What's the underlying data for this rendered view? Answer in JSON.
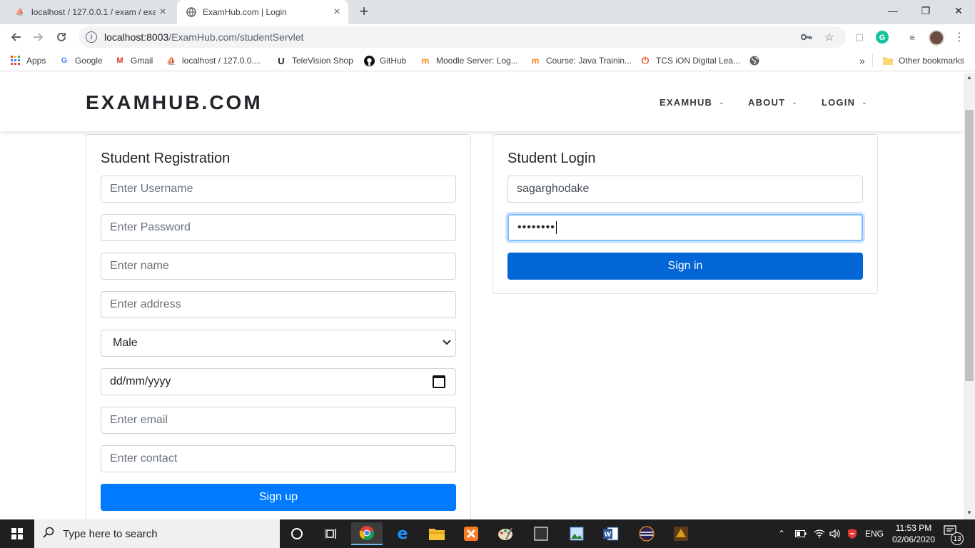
{
  "browser": {
    "tabs": [
      {
        "title": "localhost / 127.0.0.1 / exam / exa",
        "active": false,
        "favicon": "phpmyadmin-icon"
      },
      {
        "title": "ExamHub.com | Login",
        "active": true,
        "favicon": "globe-icon"
      }
    ],
    "window_controls": {
      "minimize": "—",
      "maximize": "❐",
      "close": "✕"
    },
    "url_host": "localhost:8003",
    "url_path": "/ExamHub.com/studentServlet",
    "bookmarks": [
      {
        "label": "Apps",
        "icon": "apps-grid-icon"
      },
      {
        "label": "Google",
        "icon": "google-icon"
      },
      {
        "label": "Gmail",
        "icon": "gmail-icon"
      },
      {
        "label": "localhost / 127.0.0....",
        "icon": "phpmyadmin-icon"
      },
      {
        "label": "TeleVision Shop",
        "icon": "tv-shop-icon"
      },
      {
        "label": "GitHub",
        "icon": "github-icon"
      },
      {
        "label": "Moodle Server: Log...",
        "icon": "moodle-icon"
      },
      {
        "label": "Course: Java Trainin...",
        "icon": "moodle-icon"
      },
      {
        "label": "TCS iON Digital Lea...",
        "icon": "tcs-ion-icon"
      },
      {
        "label": "",
        "icon": "globe-icon"
      }
    ],
    "overflow": "»",
    "other_bookmarks": "Other bookmarks"
  },
  "site": {
    "brand": "EXAMHUB.COM",
    "nav": [
      {
        "label": "EXAMHUB"
      },
      {
        "label": "ABOUT"
      },
      {
        "label": "LOGIN"
      }
    ]
  },
  "registration": {
    "title": "Student Registration",
    "username_placeholder": "Enter Username",
    "password_placeholder": "Enter Password",
    "name_placeholder": "Enter name",
    "address_placeholder": "Enter address",
    "gender_selected": "Male",
    "dob_placeholder": "dd/mm/yyyy",
    "email_placeholder": "Enter email",
    "contact_placeholder": "Enter contact",
    "submit_label": "Sign up"
  },
  "login": {
    "title": "Student Login",
    "username_value": "sagarghodake",
    "password_masked": "••••••••",
    "submit_label": "Sign in"
  },
  "taskbar": {
    "search_placeholder": "Type here to search",
    "language": "ENG",
    "time": "11:53 PM",
    "date": "02/06/2020",
    "notification_count": "13"
  },
  "colors": {
    "primary_button": "#007bff",
    "signin_button": "#0366d6",
    "focus_ring": "#80bdff",
    "taskbar_bg": "#1f1f1f"
  }
}
